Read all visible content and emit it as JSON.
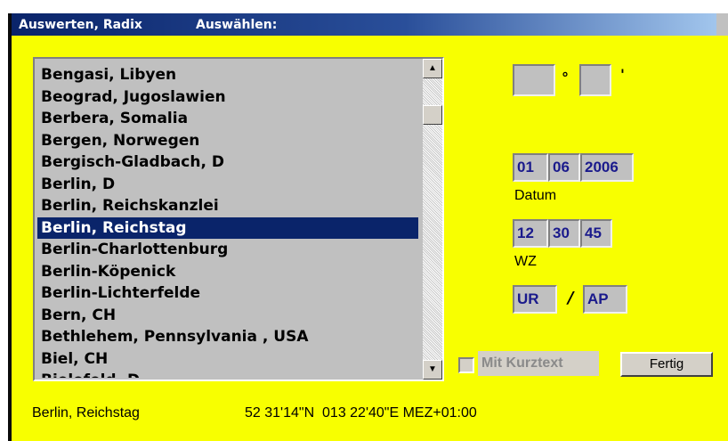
{
  "titlebar": {
    "left": "Auswerten, Radix",
    "right": "Auswählen:"
  },
  "list": {
    "items": [
      "Bengasi, Libyen",
      "Beograd, Jugoslawien",
      "Berbera, Somalia",
      "Bergen, Norwegen",
      "Bergisch-Gladbach, D",
      "Berlin, D",
      "Berlin, Reichskanzlei",
      "Berlin, Reichstag",
      "Berlin-Charlottenburg",
      "Berlin-Köpenick",
      "Berlin-Lichterfelde",
      "Bern, CH",
      "Bethlehem, Pennsylvania , USA",
      "Biel, CH",
      "Bielefeld, D"
    ],
    "selected_index": 7
  },
  "coords": {
    "deg_symbol": "°",
    "min_symbol": "'",
    "deg_value": "",
    "min_value": ""
  },
  "datum": {
    "day": "01",
    "month": "06",
    "year": "2006",
    "label": "Datum"
  },
  "wz": {
    "hour": "12",
    "minute": "30",
    "second": "45",
    "label": "WZ"
  },
  "mode": {
    "left": "UR",
    "separator": "/",
    "right": "AP"
  },
  "checkbox": {
    "label": "Mit Kurztext",
    "checked": false,
    "enabled": false
  },
  "button": {
    "label": "Fertig"
  },
  "status": {
    "place": "Berlin, Reichstag",
    "coords": "52 31'14\"N  013 22'40\"E MEZ+01:00"
  },
  "colors": {
    "background": "#f8ff00",
    "selection": "#0a246a",
    "field_text": "#1a1a8c"
  }
}
